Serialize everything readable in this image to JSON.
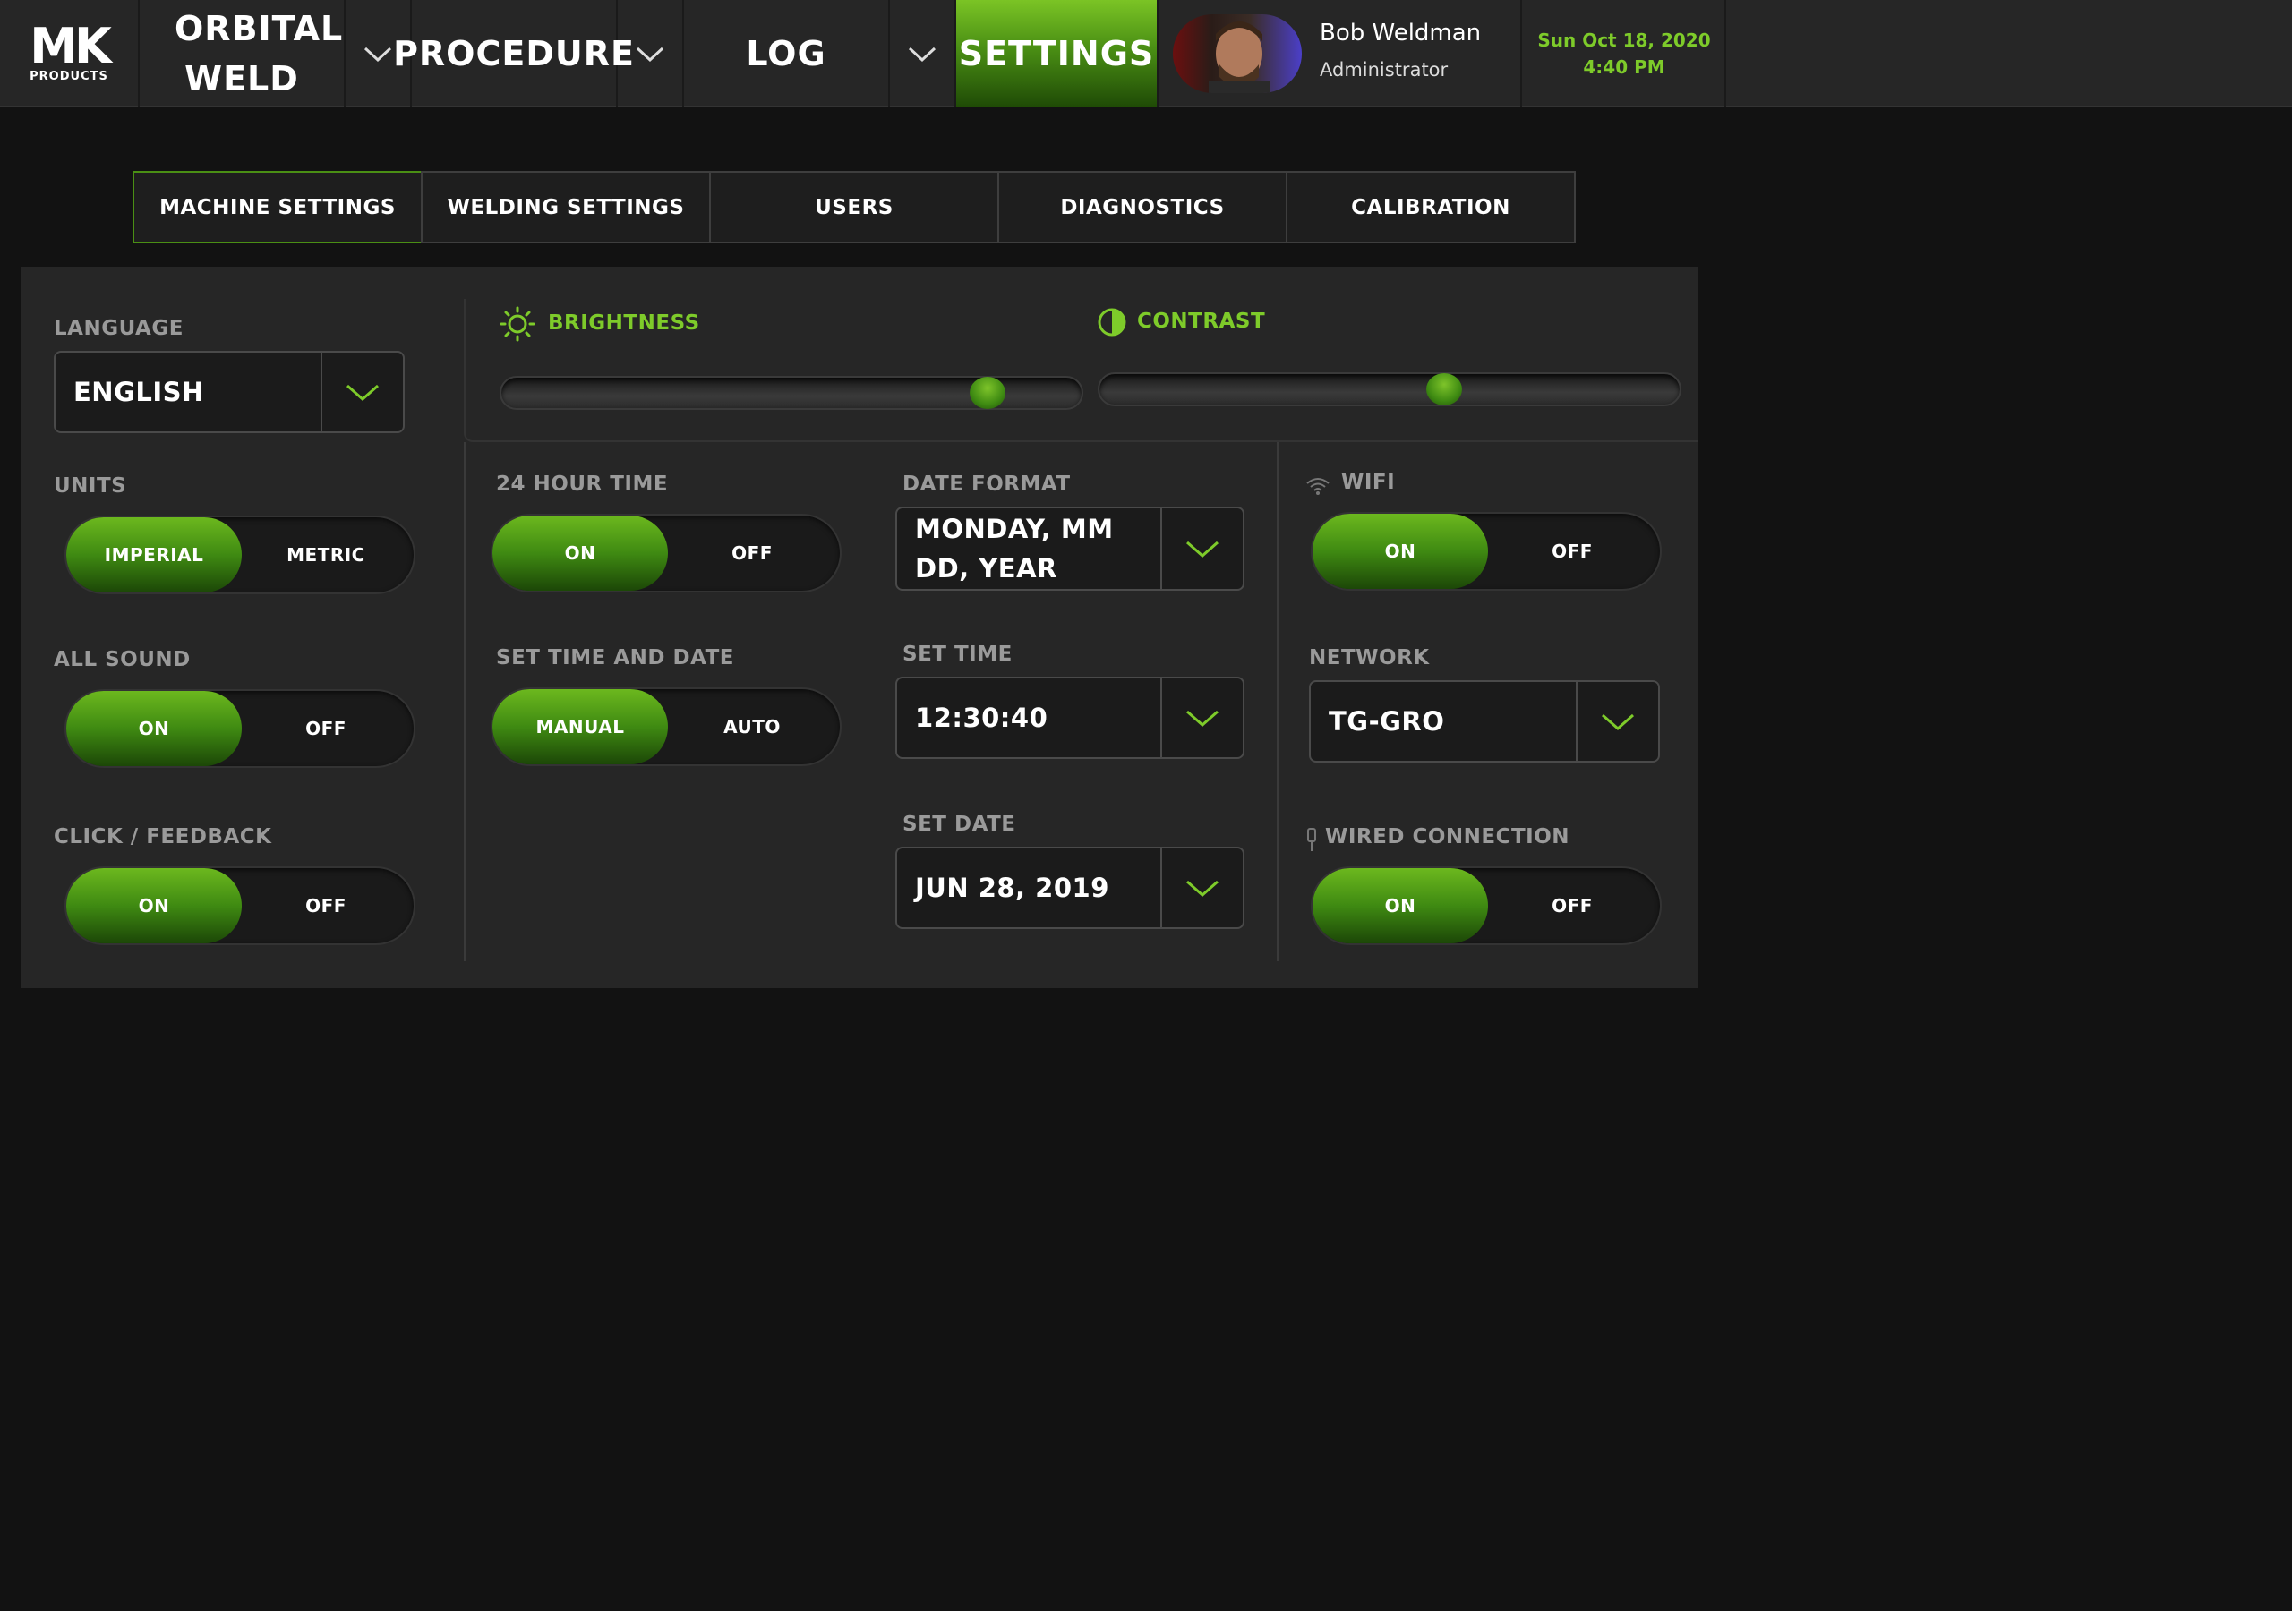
{
  "header": {
    "logo_mark": "MK",
    "logo_sub": "PRODUCTS",
    "nav": [
      {
        "label": "ORBITAL WELD"
      },
      {
        "label": "PROCEDURE"
      },
      {
        "label": "LOG"
      },
      {
        "label": "SETTINGS"
      }
    ],
    "user": {
      "name": "Bob Weldman",
      "role": "Administrator"
    },
    "date": "Sun Oct 18, 2020",
    "time": "4:40 PM"
  },
  "subtabs": [
    {
      "label": "MACHINE SETTINGS",
      "active": true
    },
    {
      "label": "WELDING SETTINGS",
      "active": false
    },
    {
      "label": "USERS",
      "active": false
    },
    {
      "label": "DIAGNOSTICS",
      "active": false
    },
    {
      "label": "CALIBRATION",
      "active": false
    }
  ],
  "settings": {
    "language": {
      "label": "LANGUAGE",
      "value": "ENGLISH"
    },
    "units": {
      "label": "UNITS",
      "options": [
        "IMPERIAL",
        "METRIC"
      ],
      "selected": "IMPERIAL"
    },
    "all_sound": {
      "label": "ALL SOUND",
      "options": [
        "ON",
        "OFF"
      ],
      "selected": "ON"
    },
    "click_feedback": {
      "label": "CLICK / FEEDBACK",
      "options": [
        "ON",
        "OFF"
      ],
      "selected": "ON"
    },
    "brightness": {
      "label": "BRIGHTNESS",
      "level": 0.86
    },
    "contrast": {
      "label": "CONTRAST",
      "level": 0.6
    },
    "hour24": {
      "label": "24 HOUR TIME",
      "options": [
        "ON",
        "OFF"
      ],
      "selected": "ON"
    },
    "set_time_date": {
      "label": "SET TIME AND DATE",
      "options": [
        "MANUAL",
        "AUTO"
      ],
      "selected": "MANUAL"
    },
    "date_format": {
      "label": "DATE FORMAT",
      "value": "MONDAY, MM DD, YEAR"
    },
    "set_time": {
      "label": "SET TIME",
      "value": "12:30:40"
    },
    "set_date": {
      "label": "SET DATE",
      "value": "JUN 28, 2019"
    },
    "wifi": {
      "label": "WIFI",
      "options": [
        "ON",
        "OFF"
      ],
      "selected": "ON"
    },
    "network": {
      "label": "NETWORK",
      "value": "TG-GRO"
    },
    "wired": {
      "label": "WIRED CONNECTION",
      "options": [
        "ON",
        "OFF"
      ],
      "selected": "ON"
    }
  },
  "colors": {
    "accent": "#7ecb2a",
    "accent_dark": "#3f8a12",
    "background": "#121212",
    "panel": "#262626"
  },
  "icons": [
    "chevron-down-icon",
    "sun-icon",
    "contrast-icon",
    "wifi-icon",
    "cable-icon"
  ]
}
